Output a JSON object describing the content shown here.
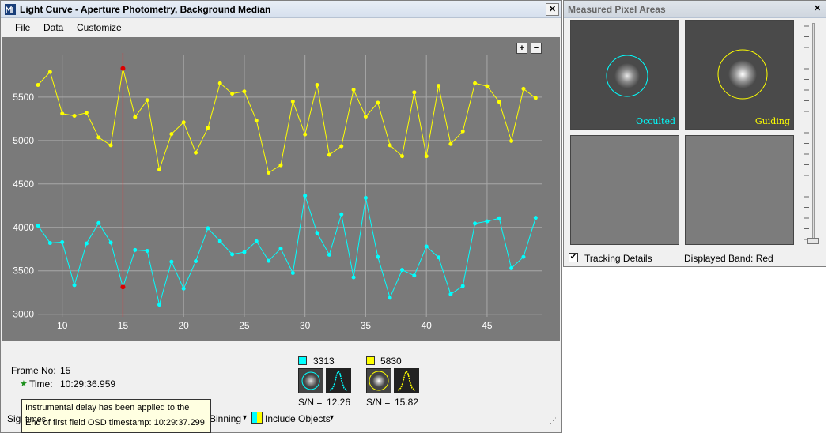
{
  "main_window": {
    "title": "Light Curve - Aperture Photometry, Background Median",
    "menu": [
      "File",
      "Data",
      "Customize"
    ],
    "zoom_in": "+",
    "zoom_out": "−"
  },
  "chart_data": {
    "type": "line",
    "xlim": [
      8,
      49.5
    ],
    "ylim": [
      2970,
      5990
    ],
    "x_ticks": [
      "10",
      "15",
      "20",
      "25",
      "30",
      "35",
      "40",
      "45"
    ],
    "y_ticks": [
      "3000",
      "3500",
      "4000",
      "4500",
      "5000",
      "5500"
    ],
    "grid": true,
    "selected_frame": 15,
    "series": [
      {
        "color": "#ffff00",
        "x": [
          8,
          9,
          10,
          11,
          12,
          13,
          14,
          15,
          16,
          17,
          18,
          19,
          20,
          21,
          22,
          23,
          24,
          25,
          26,
          27,
          28,
          29,
          30,
          31,
          32,
          33,
          34,
          35,
          36,
          37,
          38,
          39,
          40,
          41,
          42,
          43,
          44,
          45,
          46,
          47,
          48,
          49
        ],
        "values": [
          5640,
          5790,
          5310,
          5285,
          5320,
          5035,
          4945,
          5830,
          5270,
          5465,
          4665,
          5075,
          5210,
          4860,
          5145,
          5660,
          5540,
          5565,
          5230,
          4630,
          4715,
          5450,
          5070,
          5640,
          4835,
          4935,
          5585,
          5275,
          5435,
          4945,
          4820,
          5555,
          4820,
          5630,
          4960,
          5105,
          5660,
          5625,
          5445,
          4995,
          5595,
          5490
        ]
      },
      {
        "color": "#00ffff",
        "x": [
          8,
          9,
          10,
          11,
          12,
          13,
          14,
          15,
          16,
          17,
          18,
          19,
          20,
          21,
          22,
          23,
          24,
          25,
          26,
          27,
          28,
          29,
          30,
          31,
          32,
          33,
          34,
          35,
          36,
          37,
          38,
          39,
          40,
          41,
          42,
          43,
          44,
          45,
          46,
          47,
          48,
          49
        ],
        "values": [
          4020,
          3820,
          3830,
          3335,
          3815,
          4050,
          3825,
          3313,
          3740,
          3730,
          3110,
          3605,
          3295,
          3610,
          3990,
          3840,
          3690,
          3715,
          3840,
          3615,
          3755,
          3475,
          4365,
          3935,
          3685,
          4150,
          3425,
          4340,
          3660,
          3190,
          3510,
          3445,
          3780,
          3655,
          3230,
          3325,
          4045,
          4070,
          4105,
          3530,
          3660,
          4110
        ]
      }
    ]
  },
  "info": {
    "frame_label": "Frame No:",
    "frame_value": "15",
    "time_label": "Time:",
    "time_value": "10:29:36.959",
    "target1": {
      "value": "3313",
      "sn_label": "S/N =",
      "sn": "12.26",
      "color": "#00ffff"
    },
    "target2": {
      "value": "5830",
      "sn_label": "S/N =",
      "sn": "15.82",
      "color": "#ffff00"
    }
  },
  "bottom_bar": {
    "signal_partial": "Sign",
    "binning": "Binning",
    "include_objects": "Include Objects"
  },
  "tooltip": {
    "line1": "Instrumental delay has been applied to the times",
    "line2": "End of first field OSD timestamp: 10:29:37.299"
  },
  "side_window": {
    "title": "Measured Pixel Areas",
    "occulted_label": "Occulted",
    "guiding_label": "Guiding",
    "tracking_details": "Tracking Details",
    "tracking_checked": true,
    "displayed_band": "Displayed Band: Red",
    "occulted_color": "#00ffff",
    "guiding_color": "#ffff00"
  }
}
